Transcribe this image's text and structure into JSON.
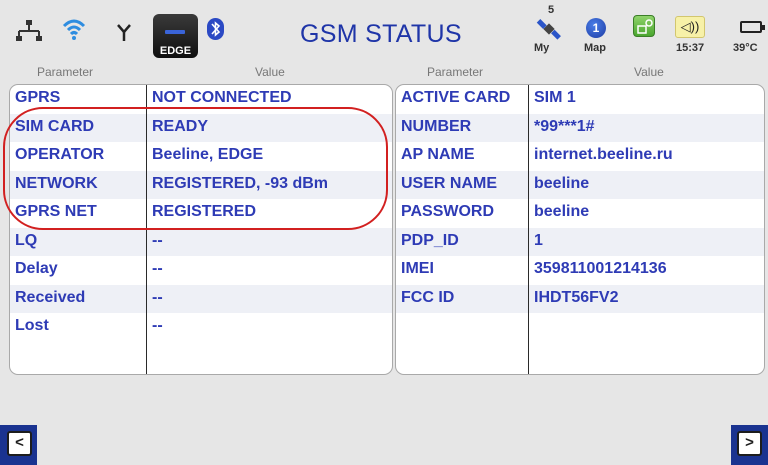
{
  "status_bar": {
    "edge_label": "EDGE",
    "title": "GSM STATUS",
    "satellites": "5",
    "sat_label": "My",
    "map_label": "Map",
    "map_num": "1",
    "time": "15:37",
    "temperature": "39°C",
    "icons": [
      "ethernet-icon",
      "wifi-icon",
      "antenna-icon",
      "edge-signal-icon",
      "bluetooth-icon",
      "satellite-icon",
      "map-icon",
      "green-app-icon",
      "volume-icon",
      "battery-icon"
    ]
  },
  "columns": {
    "left_param": "Parameter",
    "left_value": "Value",
    "right_param": "Parameter",
    "right_value": "Value"
  },
  "left_rows": [
    {
      "label": "GPRS",
      "value": "NOT CONNECTED"
    },
    {
      "label": "SIM CARD",
      "value": "READY"
    },
    {
      "label": "OPERATOR",
      "value": "Beeline, EDGE"
    },
    {
      "label": "NETWORK",
      "value": "REGISTERED, -93 dBm"
    },
    {
      "label": "GPRS NET",
      "value": "REGISTERED"
    },
    {
      "label": "LQ",
      "value": "--"
    },
    {
      "label": "Delay",
      "value": "--"
    },
    {
      "label": "Received",
      "value": "--"
    },
    {
      "label": "Lost",
      "value": "--"
    }
  ],
  "right_rows": [
    {
      "label": "ACTIVE CARD",
      "value": "SIM 1"
    },
    {
      "label": "NUMBER",
      "value": "*99***1#"
    },
    {
      "label": "AP NAME",
      "value": "internet.beeline.ru"
    },
    {
      "label": "USER NAME",
      "value": "beeline"
    },
    {
      "label": "PASSWORD",
      "value": "beeline"
    },
    {
      "label": "PDP_ID",
      "value": "1"
    },
    {
      "label": "IMEI",
      "value": "359811001214136"
    },
    {
      "label": "FCC ID",
      "value": "IHDT56FV2"
    }
  ],
  "nav": {
    "prev": "<",
    "next": ">"
  },
  "colors": {
    "text_blue": "#2e3bb5",
    "title_blue": "#1f35a8",
    "highlight_red": "#d22020",
    "nav_blue": "#1a3390"
  }
}
